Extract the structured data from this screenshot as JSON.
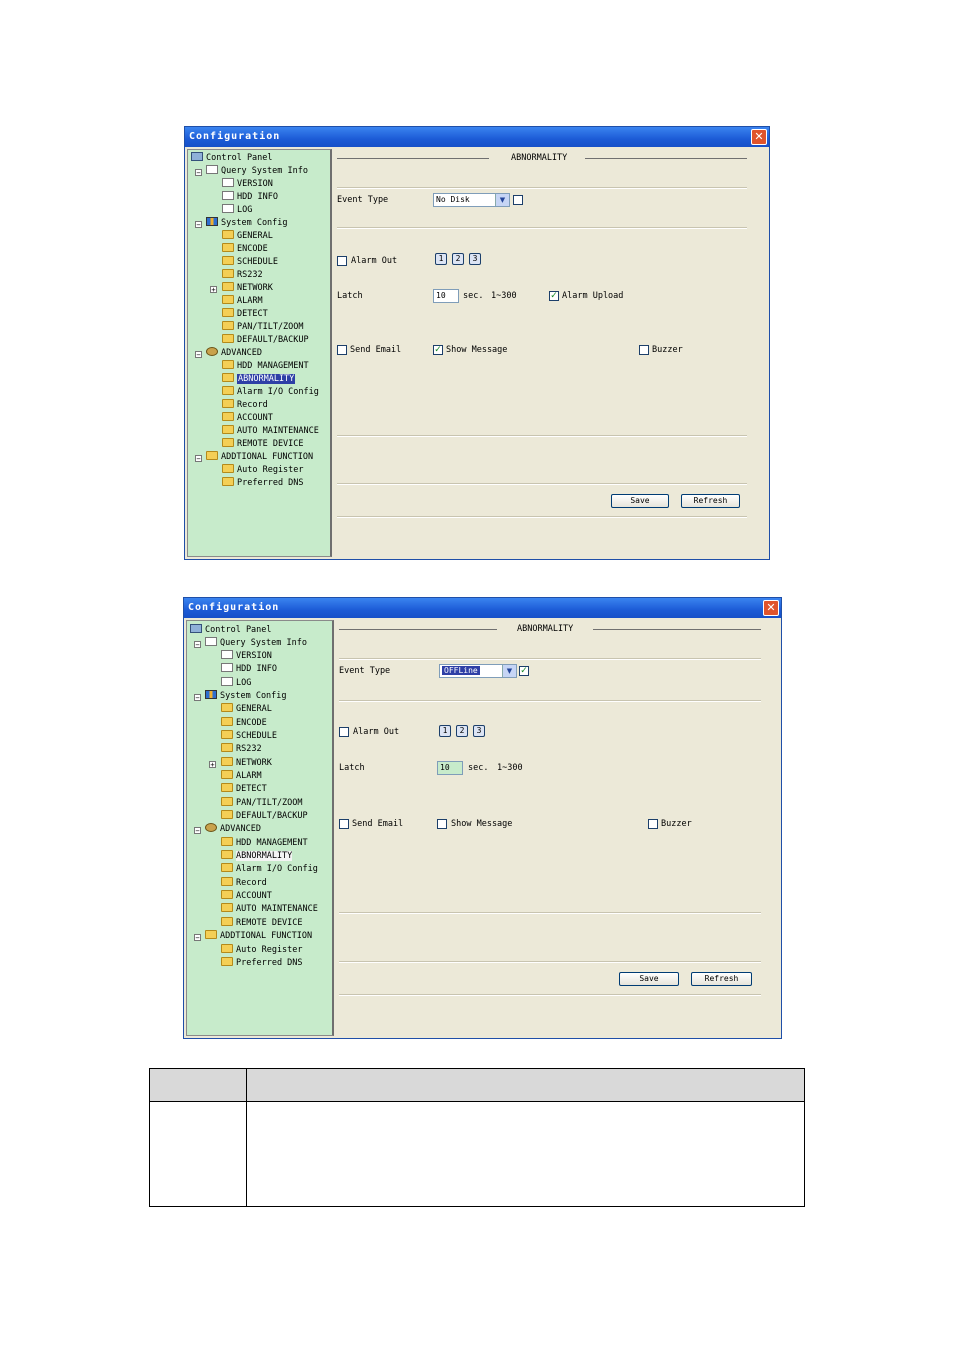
{
  "windows": [
    {
      "title": "Configuration",
      "close": "✕",
      "tree": {
        "root": "Control Panel",
        "query": "Query System Info",
        "version": "VERSION",
        "hdd_info": "HDD INFO",
        "log": "LOG",
        "system_config": "System Config",
        "general": "GENERAL",
        "encode": "ENCODE",
        "schedule": "SCHEDULE",
        "rs232": "RS232",
        "network": "NETWORK",
        "alarm": "ALARM",
        "detect": "DETECT",
        "ptz": "PAN/TILT/ZOOM",
        "default_backup": "DEFAULT/BACKUP",
        "advanced": "ADVANCED",
        "hdd_mgmt": "HDD MANAGEMENT",
        "abnormality": "ABNORMALITY",
        "alarm_io": "Alarm I/O Config",
        "record": "Record",
        "account": "ACCOUNT",
        "auto_maint": "AUTO MAINTENANCE",
        "remote_device": "REMOTE DEVICE",
        "additional": "ADDTIONAL FUNCTION",
        "auto_register": "Auto Register",
        "preferred_dns": "Preferred DNS",
        "expand_minus": "−",
        "expand_plus": "+"
      },
      "section_title": "ABNORMALITY",
      "event_type_label": "Event Type",
      "event_type_value": "No Disk",
      "event_enable_checked": false,
      "alarm_out_label": "Alarm Out",
      "alarm_out_checked": false,
      "alarm_channels": [
        "1",
        "2",
        "3"
      ],
      "latch_label": "Latch",
      "latch_value": "10",
      "latch_unit": "sec.",
      "latch_range": "1~300",
      "alarm_upload_label": "Alarm Upload",
      "alarm_upload_checked": true,
      "send_email_label": "Send Email",
      "send_email_checked": false,
      "show_message_label": "Show Message",
      "show_message_checked": true,
      "buzzer_label": "Buzzer",
      "buzzer_checked": false,
      "save_label": "Save",
      "refresh_label": "Refresh",
      "check_mark": "✓",
      "arrow": "▼"
    },
    {
      "title": "Configuration",
      "close": "✕",
      "tree": {
        "root": "Control Panel",
        "query": "Query System Info",
        "version": "VERSION",
        "hdd_info": "HDD INFO",
        "log": "LOG",
        "system_config": "System Config",
        "general": "GENERAL",
        "encode": "ENCODE",
        "schedule": "SCHEDULE",
        "rs232": "RS232",
        "network": "NETWORK",
        "alarm": "ALARM",
        "detect": "DETECT",
        "ptz": "PAN/TILT/ZOOM",
        "default_backup": "DEFAULT/BACKUP",
        "advanced": "ADVANCED",
        "hdd_mgmt": "HDD MANAGEMENT",
        "abnormality": "ABNORMALITY",
        "alarm_io": "Alarm I/O Config",
        "record": "Record",
        "account": "ACCOUNT",
        "auto_maint": "AUTO MAINTENANCE",
        "remote_device": "REMOTE DEVICE",
        "additional": "ADDTIONAL FUNCTION",
        "auto_register": "Auto Register",
        "preferred_dns": "Preferred DNS",
        "expand_minus": "−",
        "expand_plus": "+"
      },
      "section_title": "ABNORMALITY",
      "event_type_label": "Event Type",
      "event_type_value": "OFFLine",
      "event_enable_checked": true,
      "alarm_out_label": "Alarm Out",
      "alarm_out_checked": false,
      "alarm_channels": [
        "1",
        "2",
        "3"
      ],
      "latch_label": "Latch",
      "latch_value": "10",
      "latch_unit": "sec.",
      "latch_range": "1~300",
      "send_email_label": "Send Email",
      "send_email_checked": false,
      "show_message_label": "Show Message",
      "show_message_checked": false,
      "buzzer_label": "Buzzer",
      "buzzer_checked": false,
      "save_label": "Save",
      "refresh_label": "Refresh",
      "check_mark": "✓",
      "arrow": "▼"
    }
  ],
  "colors": {
    "tree_bg": "#c7ebcb",
    "window_bg": "#ece9d8",
    "titlebar": "#1c5bd6",
    "selection": "#2e3fa6"
  }
}
